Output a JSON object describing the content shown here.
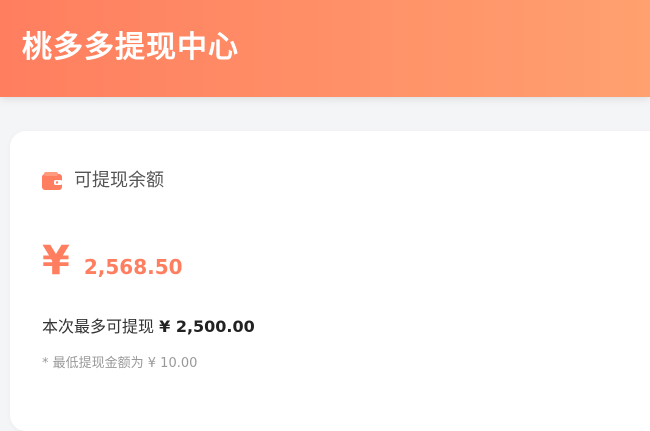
{
  "header": {
    "title": "桃多多提现中心"
  },
  "balance": {
    "icon": "wallet-icon",
    "label": "可提现余额",
    "currency_symbol": "¥",
    "amount": "2,568.50"
  },
  "withdraw": {
    "max_label": "本次最多可提现",
    "max_value": "¥ 2,500.00",
    "min_note": "* 最低提现金额为 ¥ 10.00"
  },
  "colors": {
    "accent": "#ff7e5f",
    "header_gradient_start": "#ff7e5f",
    "header_gradient_end": "#ffa06f"
  }
}
